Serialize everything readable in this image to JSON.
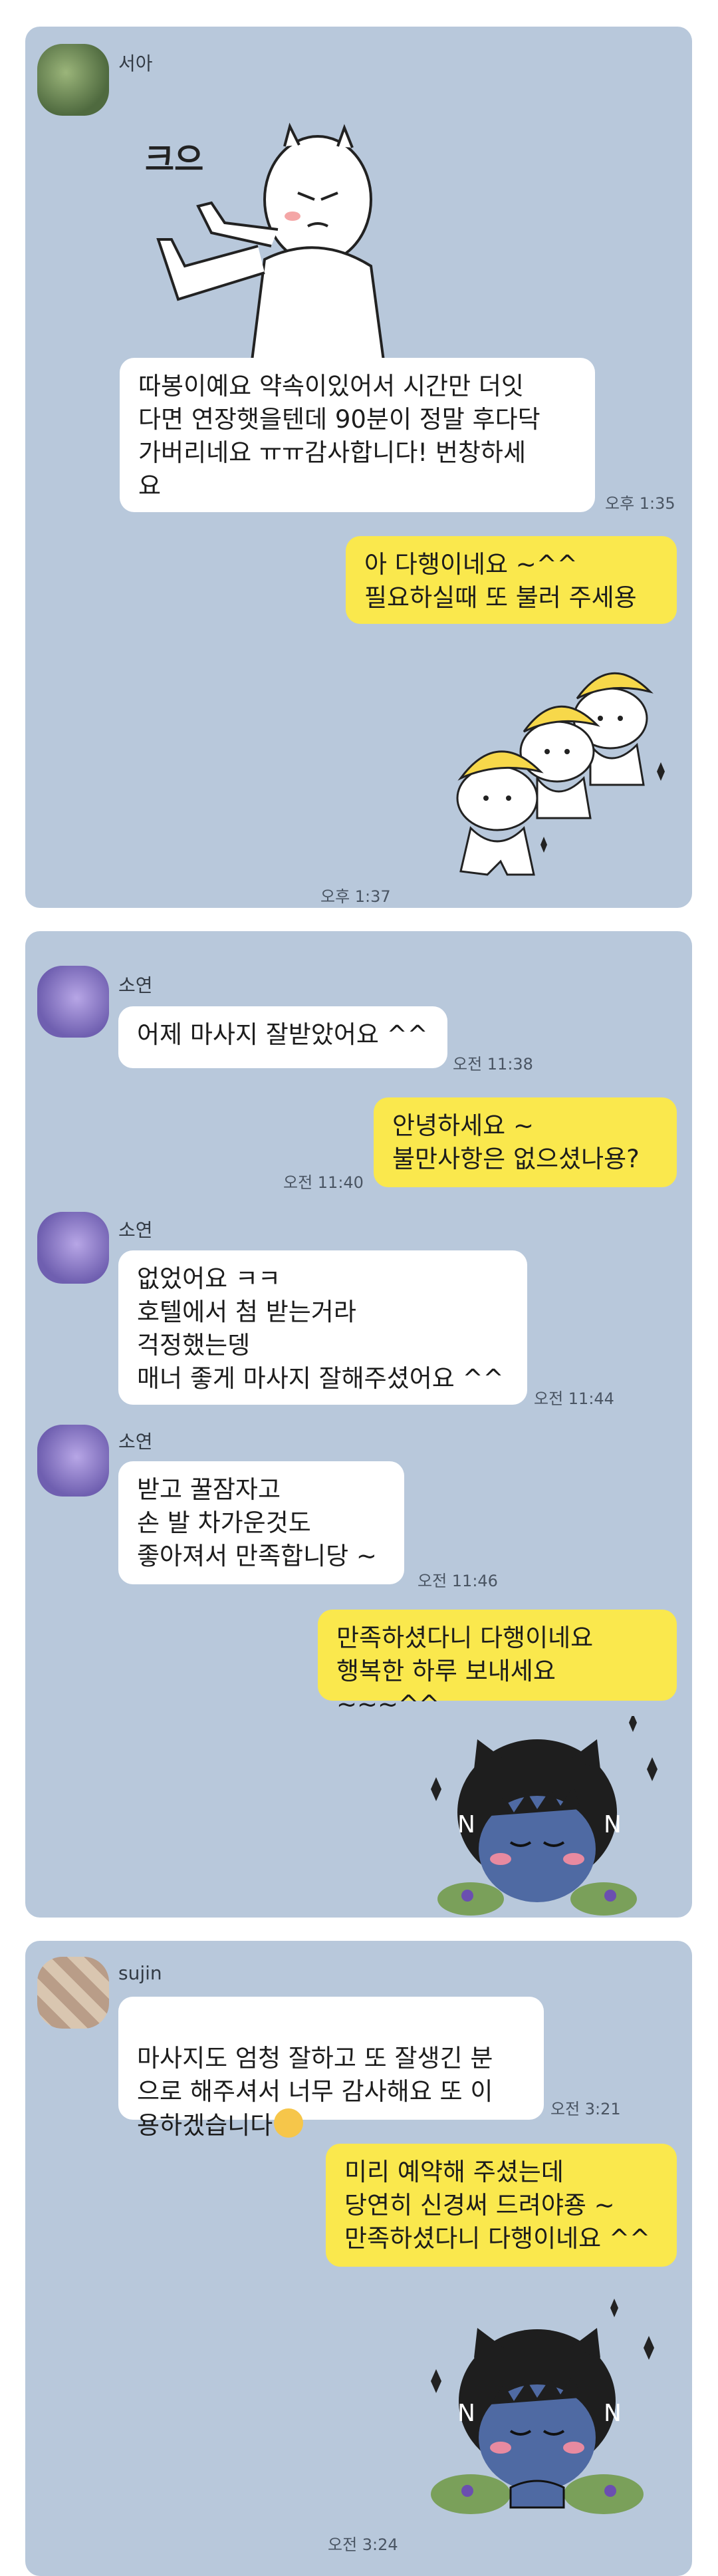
{
  "chats": [
    {
      "sender": "서아",
      "sticker_text": "크으",
      "incoming": "따봉이예요 약속이있어서 시간만 더잇\n다면 연장햇을텐데 90분이 정말 후다닥\n가버리네요 ㅠㅠ감사합니다! 번창하세\n요",
      "incoming_time": "오후 1:35",
      "outgoing": "아 다행이네요 ~^^\n필요하실때 또 불러 주세용",
      "sticker_time": "오후 1:37"
    },
    {
      "messages": [
        {
          "sender": "소연",
          "text": "어제 마사지 잘받았어요 ^^",
          "time": "오전 11:38"
        },
        {
          "text": "안녕하세요 ~\n불만사항은 없으셨나용?",
          "time": "오전 11:40"
        },
        {
          "sender": "소연",
          "text": "없었어요 ㅋㅋ\n호텔에서 첨 받는거라\n걱정했는뎅\n매너 좋게 마사지 잘해주셨어요 ^^",
          "time": "오전 11:44"
        },
        {
          "sender": "소연",
          "text": "받고 꿀잠자고\n손 발 차가운것도\n좋아져서 만족합니당 ~",
          "time": "오전 11:46"
        },
        {
          "text": "만족하셨다니 다행이네요\n행복한 하루 보내세요 ~~~^^"
        }
      ]
    },
    {
      "sender": "sujin",
      "incoming": "마사지도 엄청 잘하고 또 잘생긴 분\n으로 해주셔서 너무 감사해요 또 이\n용하겠습니다",
      "incoming_time": "오전 3:21",
      "outgoing": "미리 예약해 주셨는데\n당연히 신경써 드려야죵 ~\n만족하셨다니 다행이네요 ^^",
      "sticker_time": "오전 3:24"
    }
  ]
}
